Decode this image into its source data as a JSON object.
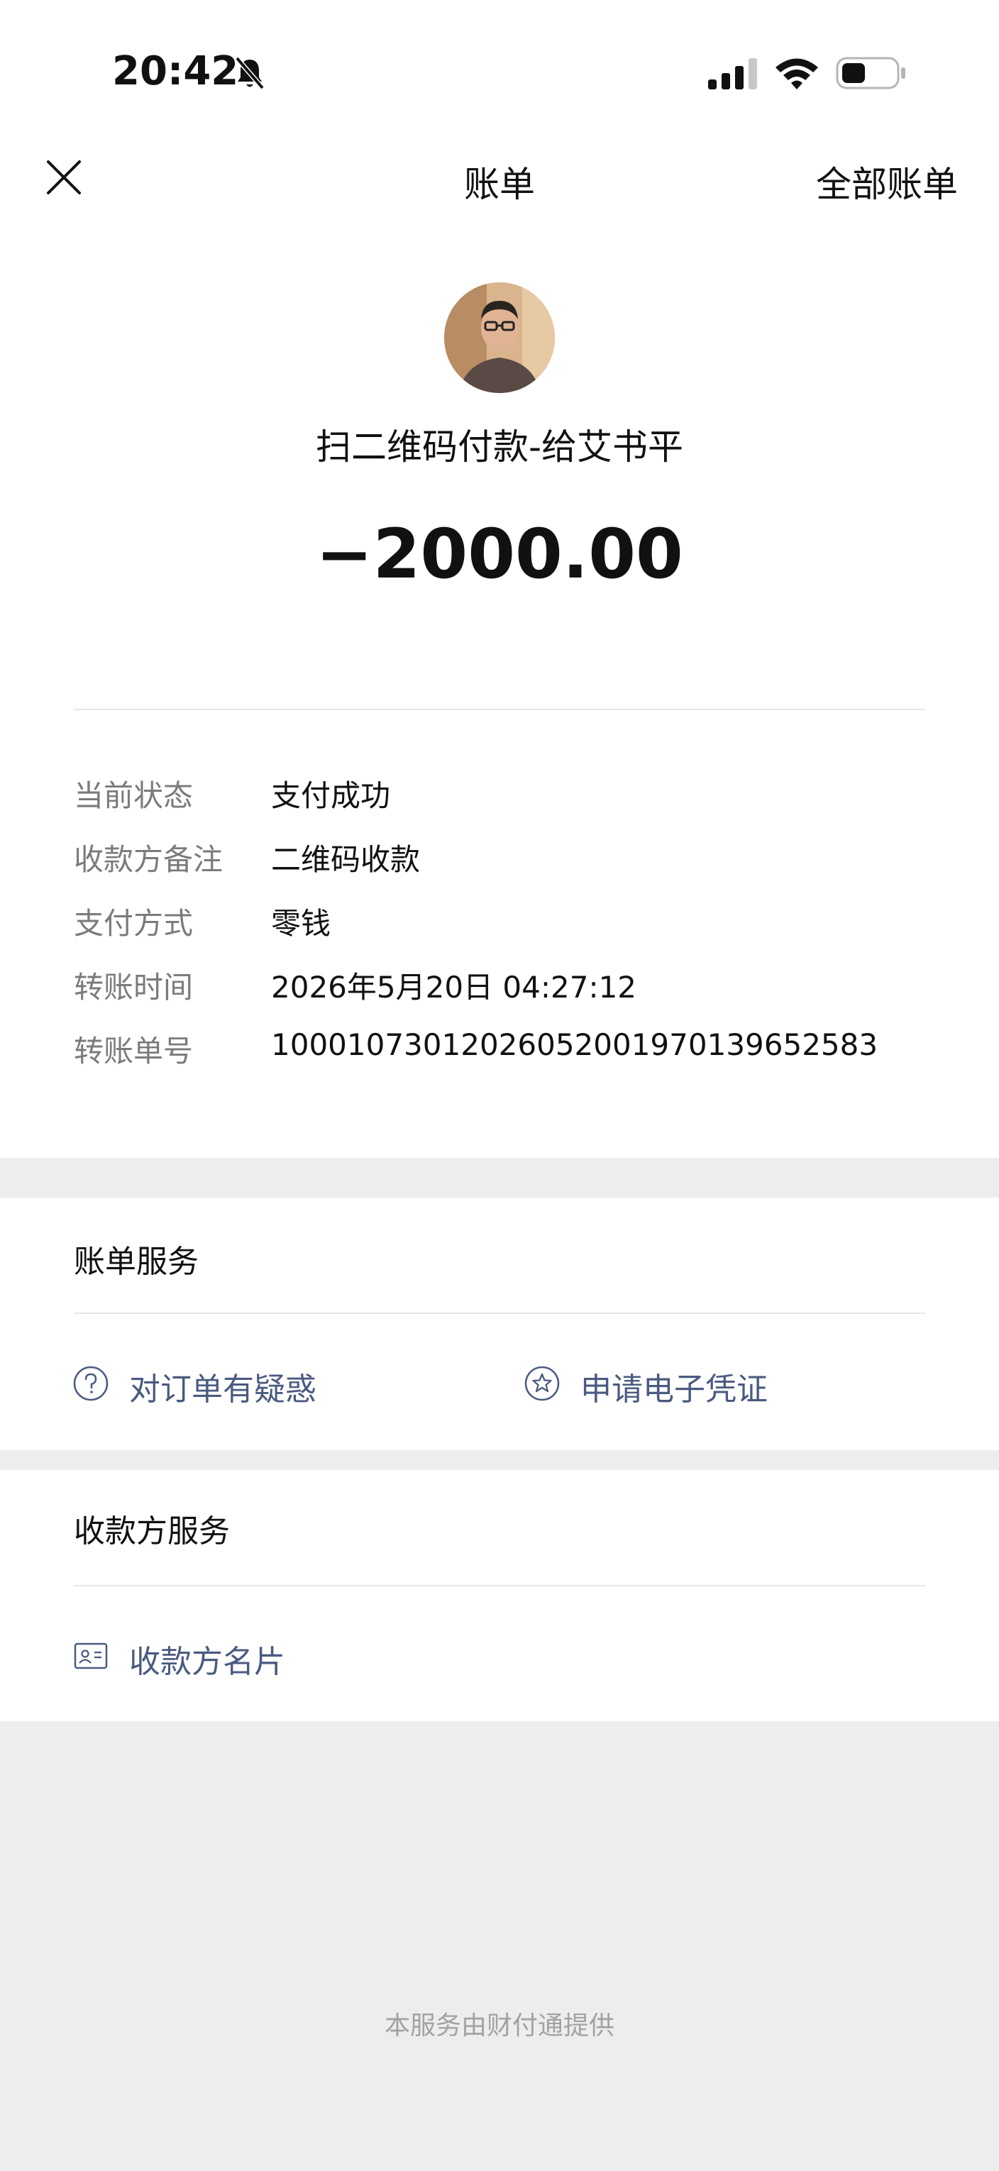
{
  "status_bar": {
    "time": "20:42"
  },
  "nav": {
    "title": "账单",
    "right_link": "全部账单"
  },
  "header": {
    "payee_text": "扫二维码付款-给艾书平",
    "amount": "−2000.00"
  },
  "details": [
    {
      "label": "当前状态",
      "value": "支付成功"
    },
    {
      "label": "收款方备注",
      "value": "二维码收款"
    },
    {
      "label": "支付方式",
      "value": "零钱"
    },
    {
      "label": "转账时间",
      "value": "2026年5月20日 04:27:12"
    },
    {
      "label": "转账单号",
      "value": "1000107301202605200197013965​2583"
    }
  ],
  "bill_service": {
    "title": "账单服务",
    "links": [
      {
        "label": "对订单有疑惑",
        "icon": "question-circle-icon"
      },
      {
        "label": "申请电子凭证",
        "icon": "star-circle-icon"
      }
    ]
  },
  "payee_service": {
    "title": "收款方服务",
    "links": [
      {
        "label": "收款方名片",
        "icon": "id-card-icon"
      }
    ]
  },
  "footer": {
    "text": "本服务由财付通提供"
  },
  "colors": {
    "link": "#4a5a80",
    "muted": "#7b7b7b",
    "background": "#ededed"
  }
}
